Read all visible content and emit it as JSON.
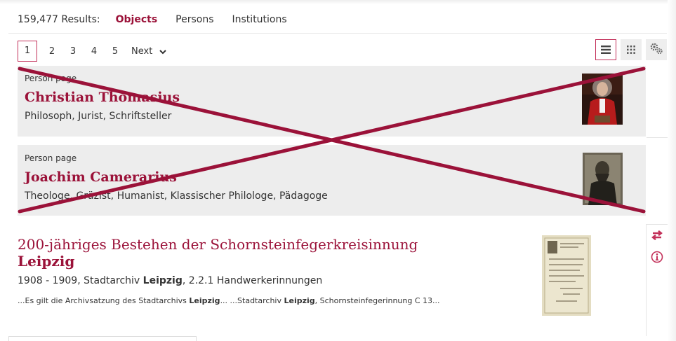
{
  "results": {
    "count_label": "159,477 Results:",
    "tabs": [
      {
        "label": "Objects",
        "active": true
      },
      {
        "label": "Persons",
        "active": false
      },
      {
        "label": "Institutions",
        "active": false
      }
    ]
  },
  "pagination": {
    "pages": [
      "1",
      "2",
      "3",
      "4",
      "5"
    ],
    "current": "1",
    "next_label": "Next"
  },
  "view_controls": {
    "list_icon": "list-view-icon",
    "grid_icon": "grid-view-icon",
    "settings_icon": "settings-gears-icon"
  },
  "person_results": [
    {
      "kicker": "Person page",
      "name": "Christian Thomasius",
      "description": "Philosoph, Jurist, Schriftsteller"
    },
    {
      "kicker": "Person page",
      "name": "Joachim Camerarius",
      "description": "Theologe, Gräzist, Humanist, Klassischer Philologe, Pädagoge"
    }
  ],
  "object_result": {
    "title_prefix": "200-jähriges Bestehen der Schornsteinfegerkreisinnung",
    "title_highlight": "Leipzig",
    "meta_prefix": "1908 - 1909, Stadtarchiv ",
    "meta_highlight": "Leipzig",
    "meta_suffix": ", 2.2.1 Handwerkerinnungen",
    "snippet_1": "...Es gilt die Archivsatzung des Stadtarchivs ",
    "snippet_2": "Leipzig",
    "snippet_3": "... ...Stadtarchiv ",
    "snippet_4": "Leipzig",
    "snippet_5": ", Schornsteinfegerinnung C 13..."
  },
  "side_actions": {
    "compare_icon": "compare-arrows-icon",
    "info_icon": "info-icon"
  },
  "colors": {
    "accent": "#9b1239",
    "accent_border": "#c3315a",
    "card_bg": "#ededed",
    "cross_stroke": "#9b1239"
  }
}
